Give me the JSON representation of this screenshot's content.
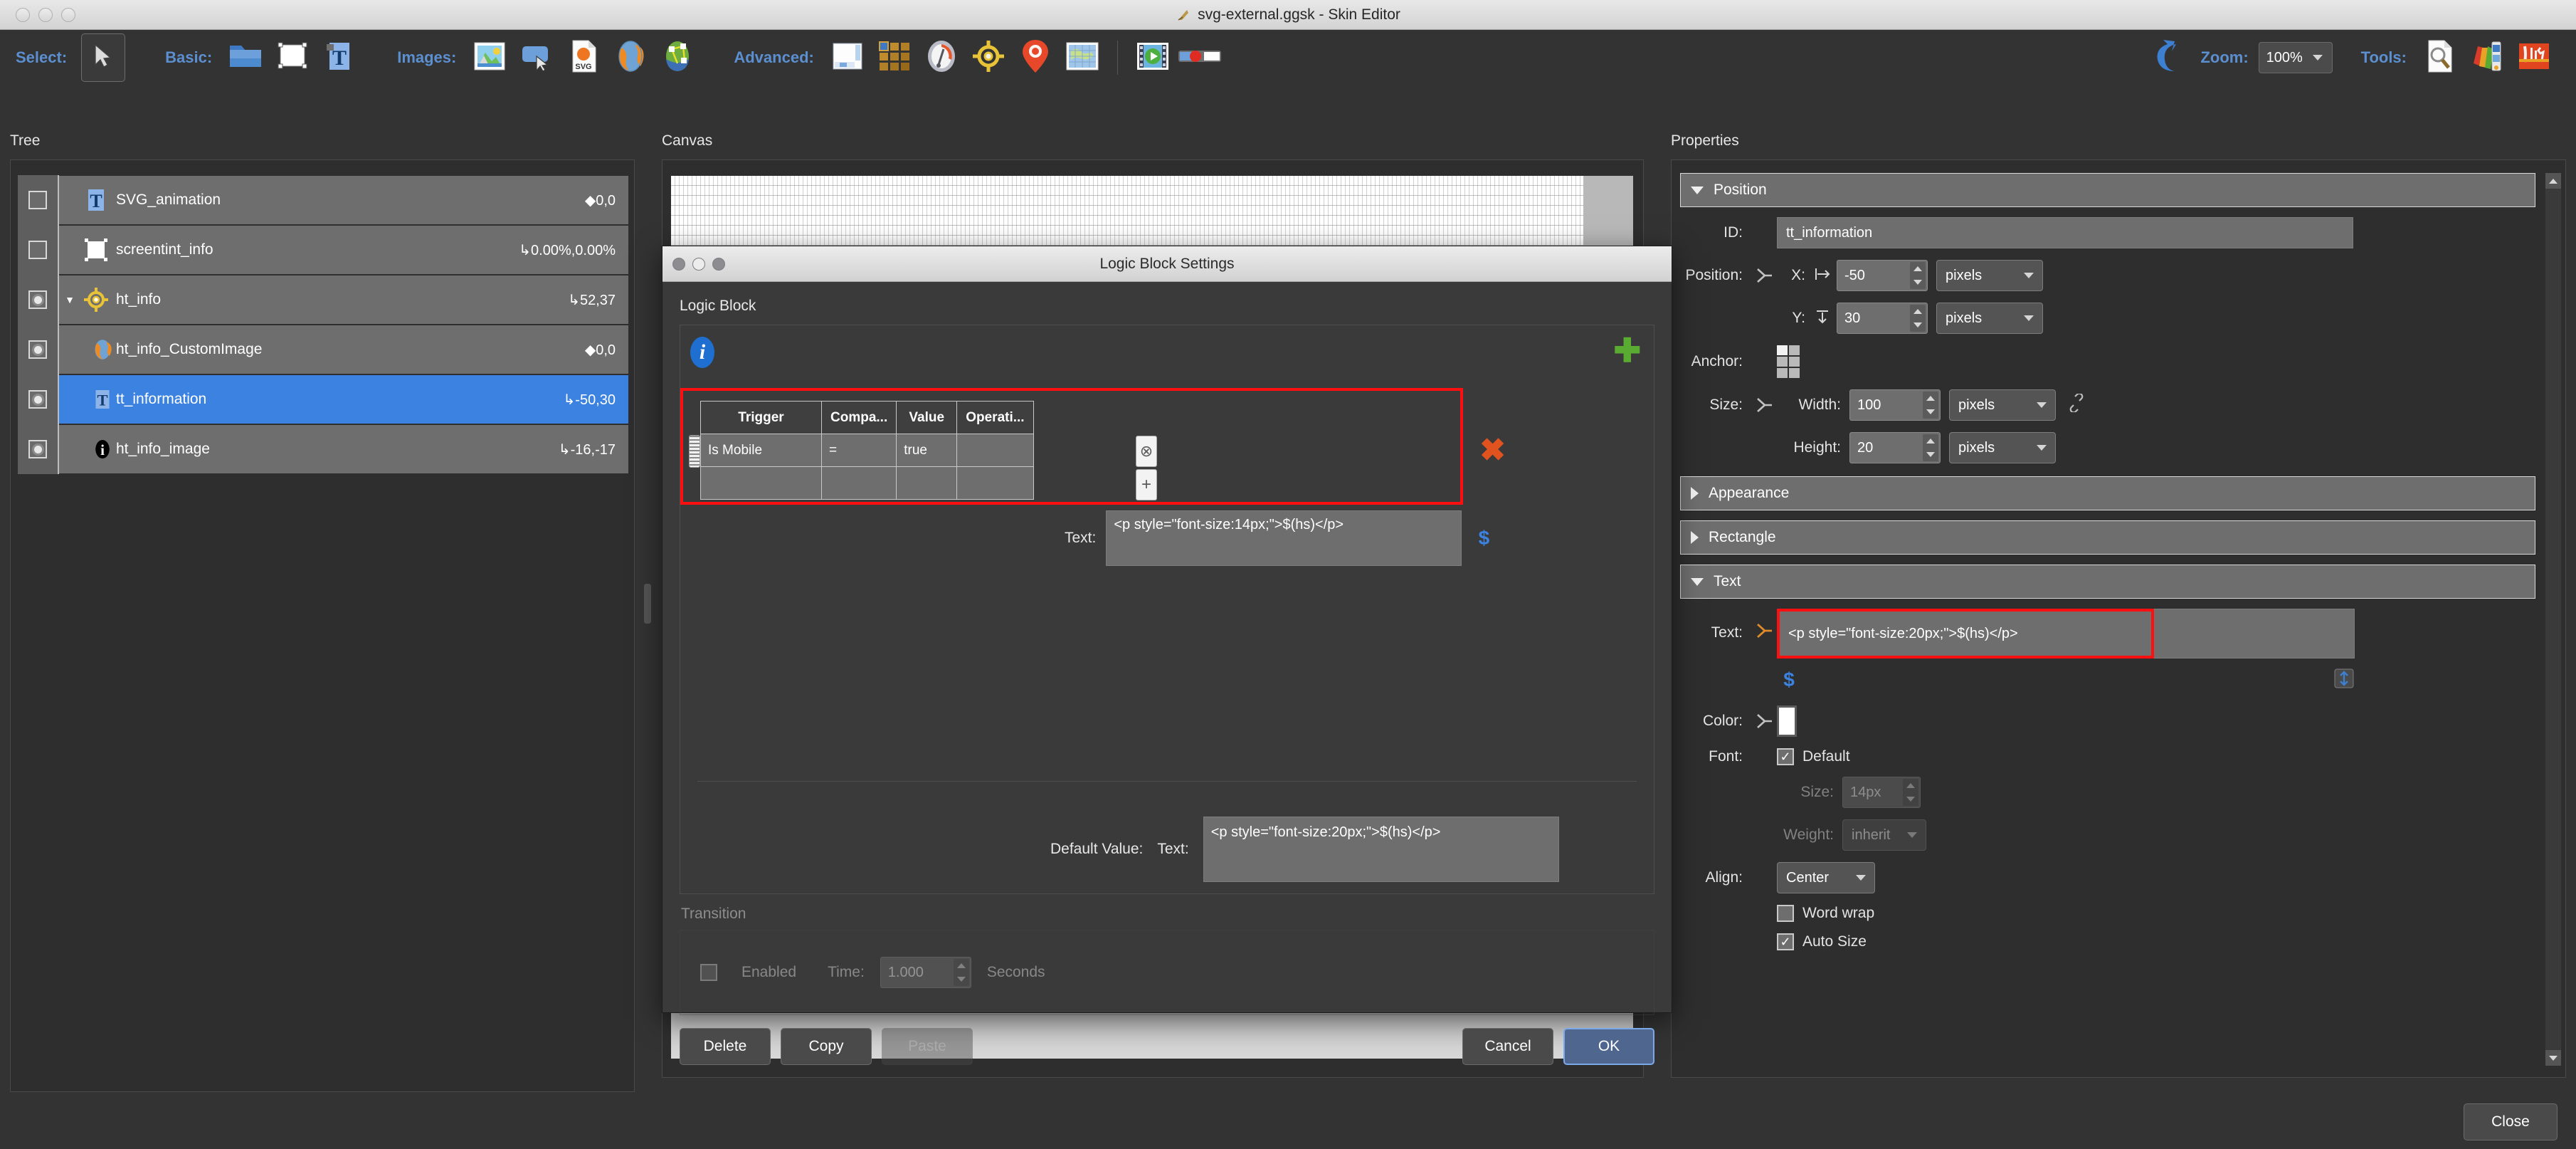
{
  "window": {
    "title": "svg-external.ggsk - Skin Editor",
    "app_icon": "feather-icon"
  },
  "toolbar": {
    "groups": [
      {
        "label": "Select:",
        "items": [
          {
            "name": "pointer-tool",
            "icon": "cursor-arrow-icon",
            "active": true
          }
        ]
      },
      {
        "label": "Basic:",
        "items": [
          {
            "name": "folder-tool",
            "icon": "folder-icon"
          },
          {
            "name": "rectangle-tool",
            "icon": "rectangle-icon"
          },
          {
            "name": "text-tool",
            "icon": "text-t-icon"
          }
        ]
      },
      {
        "label": "Images:",
        "items": [
          {
            "name": "image-tool",
            "icon": "picture-icon"
          },
          {
            "name": "button-tool",
            "icon": "button-cursor-icon"
          },
          {
            "name": "svg-tool",
            "icon": "svg-file-icon"
          },
          {
            "name": "globe-tool",
            "icon": "globe-orange-icon"
          },
          {
            "name": "hotspot-tool",
            "icon": "globe-nodes-icon"
          }
        ]
      },
      {
        "label": "Advanced:",
        "items": [
          {
            "name": "container-tool",
            "icon": "window-panel-icon"
          },
          {
            "name": "thumbnail-grid-tool",
            "icon": "grid-tiles-icon"
          },
          {
            "name": "compass-tool",
            "icon": "compass-gauge-icon"
          },
          {
            "name": "radar-tool",
            "icon": "crosshair-icon"
          },
          {
            "name": "map-pin-tool",
            "icon": "map-pin-icon"
          },
          {
            "name": "world-map-tool",
            "icon": "world-map-icon"
          }
        ]
      },
      {
        "label": "",
        "items": [
          {
            "name": "video-tool",
            "icon": "film-play-icon"
          },
          {
            "name": "slider-tool",
            "icon": "slider-control-icon"
          }
        ]
      }
    ],
    "undo": {
      "name": "undo-button",
      "icon": "undo-arrow-icon"
    },
    "zoom_label": "Zoom:",
    "zoom_value": "100%",
    "tools_label": "Tools:",
    "tools": [
      {
        "name": "inspect-tool",
        "icon": "magnifier-document-icon"
      },
      {
        "name": "palette-tool",
        "icon": "color-palette-icon"
      },
      {
        "name": "toolbox-tool",
        "icon": "toolbox-icon"
      }
    ]
  },
  "tree": {
    "heading": "Tree",
    "rows": [
      {
        "name": "SVG_animation",
        "coord": "◆0,0",
        "icon": "text-t-icon",
        "visible": false,
        "indent": 1,
        "expander": "",
        "selected": false
      },
      {
        "name": "screentint_info",
        "coord": "↳0.00%,0.00%",
        "icon": "rectangle-icon",
        "visible": false,
        "indent": 1,
        "expander": "",
        "selected": false
      },
      {
        "name": "ht_info",
        "coord": "↳52,37",
        "icon": "crosshair-icon",
        "visible": true,
        "indent": 0,
        "expander": "▼",
        "selected": false
      },
      {
        "name": "ht_info_CustomImage",
        "coord": "◆0,0",
        "icon": "globe-orange-icon",
        "visible": true,
        "indent": 2,
        "expander": "",
        "selected": false
      },
      {
        "name": "tt_information",
        "coord": "↳-50,30",
        "icon": "text-t-icon",
        "visible": true,
        "indent": 2,
        "expander": "",
        "selected": true
      },
      {
        "name": "ht_info_image",
        "coord": "↳-16,-17",
        "icon": "info-circle-icon",
        "visible": true,
        "indent": 2,
        "expander": "",
        "selected": false
      }
    ]
  },
  "canvas": {
    "heading": "Canvas"
  },
  "dialog": {
    "title": "Logic Block Settings",
    "section_label": "Logic Block",
    "info_icon": "info-icon",
    "add_icon": "plus-icon",
    "delete_icon": "delete-x-icon",
    "table": {
      "headers": [
        "Trigger",
        "Compa...",
        "Value",
        "Operati..."
      ],
      "rows": [
        {
          "trigger": "Is Mobile",
          "comparison": "=",
          "value": "true",
          "operation": ""
        },
        {
          "trigger": "",
          "comparison": "",
          "value": "",
          "operation": ""
        }
      ]
    },
    "text_label": "Text:",
    "text_value": "<p style=\"font-size:14px;\">$(hs)</p>",
    "variable_icon": "dollar-icon",
    "default_value_label": "Default Value:",
    "default_text_label": "Text:",
    "default_text_value": "<p style=\"font-size:20px;\">$(hs)</p>",
    "transition": {
      "label": "Transition",
      "enabled_label": "Enabled",
      "enabled_checked": false,
      "time_label": "Time:",
      "time_value": "1.000",
      "seconds_label": "Seconds"
    },
    "buttons": {
      "delete": "Delete",
      "copy": "Copy",
      "paste": "Paste",
      "cancel": "Cancel",
      "ok": "OK"
    }
  },
  "properties": {
    "heading": "Properties",
    "sections": {
      "position": {
        "title": "Position",
        "expanded": true,
        "id_label": "ID:",
        "id_value": "tt_information",
        "position_label": "Position:",
        "x_label": "X:",
        "x_value": "-50",
        "x_unit": "pixels",
        "y_label": "Y:",
        "y_value": "30",
        "y_unit": "pixels",
        "anchor_label": "Anchor:",
        "size_label": "Size:",
        "width_label": "Width:",
        "width_value": "100",
        "width_unit": "pixels",
        "height_label": "Height:",
        "height_value": "20",
        "height_unit": "pixels"
      },
      "appearance": {
        "title": "Appearance",
        "expanded": false
      },
      "rectangle": {
        "title": "Rectangle",
        "expanded": false
      },
      "text": {
        "title": "Text",
        "expanded": true,
        "text_label": "Text:",
        "text_value": "<p style=\"font-size:20px;\">$(hs)</p>",
        "variable_icon": "dollar-icon",
        "expand_icon": "expand-editor-icon",
        "color_label": "Color:",
        "color_value": "#ffffff",
        "font_label": "Font:",
        "font_default_label": "Default",
        "font_default_checked": true,
        "size_label": "Size:",
        "size_value": "14px",
        "weight_label": "Weight:",
        "weight_value": "inherit",
        "align_label": "Align:",
        "align_value": "Center",
        "word_wrap_label": "Word wrap",
        "word_wrap_checked": false,
        "auto_size_label": "Auto Size",
        "auto_size_checked": true
      }
    }
  },
  "footer": {
    "close_label": "Close"
  },
  "colors": {
    "accent_blue": "#5b8fd0",
    "selection_blue": "#3c82e0",
    "highlight_red": "#ff0f0f"
  }
}
